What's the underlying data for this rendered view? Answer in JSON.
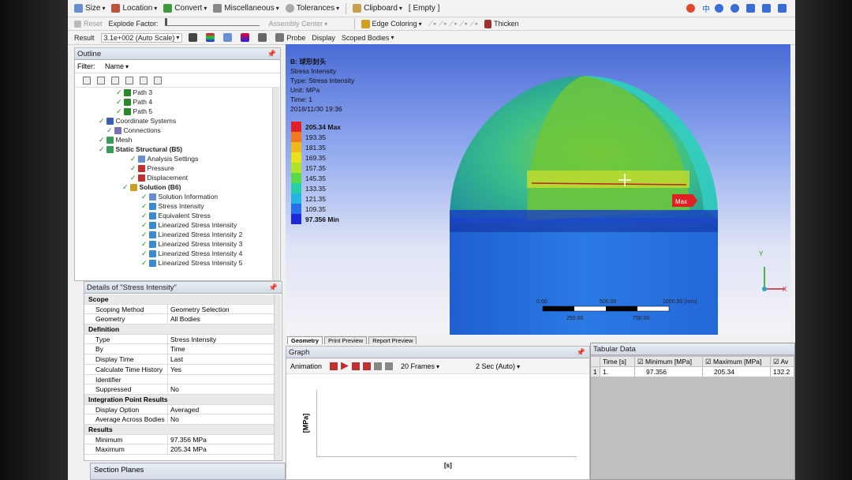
{
  "toolbar1": {
    "size": "Size",
    "location": "Location",
    "convert": "Convert",
    "misc": "Miscellaneous",
    "tolerances": "Tolerances",
    "clipboard": "Clipboard",
    "empty": "[ Empty ]"
  },
  "toolbar2": {
    "reset": "Reset",
    "explode": "Explode Factor:",
    "assembly": "Assembly Center",
    "edge_coloring": "Edge Coloring",
    "thicken": "Thicken"
  },
  "toolbar3": {
    "result_label": "Result",
    "scale": "3.1e+002 (Auto Scale)",
    "probe": "Probe",
    "display": "Display",
    "scoped": "Scoped Bodies"
  },
  "outline": {
    "title": "Outline",
    "filter_label": "Filter:",
    "filter_value": "Name",
    "items": [
      {
        "label": "Path 3",
        "indent": 0
      },
      {
        "label": "Path 4",
        "indent": 0
      },
      {
        "label": "Path 5",
        "indent": 0
      },
      {
        "label": "Coordinate Systems",
        "indent": 0
      },
      {
        "label": "Connections",
        "indent": 0
      },
      {
        "label": "Mesh",
        "indent": 0
      },
      {
        "label": "Static Structural (B5)",
        "indent": 0
      },
      {
        "label": "Analysis Settings",
        "indent": 1
      },
      {
        "label": "Pressure",
        "indent": 1
      },
      {
        "label": "Displacement",
        "indent": 1
      },
      {
        "label": "Solution (B6)",
        "indent": 1
      },
      {
        "label": "Solution Information",
        "indent": 2
      },
      {
        "label": "Stress Intensity",
        "indent": 2
      },
      {
        "label": "Equivalent Stress",
        "indent": 2
      },
      {
        "label": "Linearized Stress Intensity",
        "indent": 2
      },
      {
        "label": "Linearized Stress Intensity 2",
        "indent": 2
      },
      {
        "label": "Linearized Stress Intensity 3",
        "indent": 2
      },
      {
        "label": "Linearized Stress Intensity 4",
        "indent": 2
      },
      {
        "label": "Linearized Stress Intensity 5",
        "indent": 2
      }
    ]
  },
  "details": {
    "title": "Details of \"Stress Intensity\"",
    "rows": [
      {
        "k": "Scope",
        "v": "",
        "section": true
      },
      {
        "k": "Scoping Method",
        "v": "Geometry Selection"
      },
      {
        "k": "Geometry",
        "v": "All Bodies"
      },
      {
        "k": "Definition",
        "v": "",
        "section": true
      },
      {
        "k": "Type",
        "v": "Stress Intensity"
      },
      {
        "k": "By",
        "v": "Time"
      },
      {
        "k": "Display Time",
        "v": "Last"
      },
      {
        "k": "Calculate Time History",
        "v": "Yes"
      },
      {
        "k": "Identifier",
        "v": ""
      },
      {
        "k": "Suppressed",
        "v": "No"
      },
      {
        "k": "Integration Point Results",
        "v": "",
        "section": true
      },
      {
        "k": "Display Option",
        "v": "Averaged"
      },
      {
        "k": "Average Across Bodies",
        "v": "No"
      },
      {
        "k": "Results",
        "v": "",
        "section": true
      },
      {
        "k": "Minimum",
        "v": "97.356 MPa"
      },
      {
        "k": "Maximum",
        "v": "205.34 MPa"
      }
    ]
  },
  "section_planes": "Section Planes",
  "viewport": {
    "line1": "B: 球形封头",
    "line2": "Stress Intensity",
    "line3": "Type: Stress Intensity",
    "line4": "Unit: MPa",
    "line5": "Time: 1",
    "line6": "2018/11/30 19:36",
    "max_tag": "Max",
    "scale_top": [
      "0.00",
      "500.00",
      "1000.00 (mm)"
    ],
    "scale_bottom": [
      "250.00",
      "750.00"
    ],
    "axis_y": "Y",
    "axis_x": "X"
  },
  "legend": [
    {
      "label": "205.34 Max",
      "color": "#e0202a",
      "bold": true
    },
    {
      "label": "193.35",
      "color": "#f07a1a"
    },
    {
      "label": "181.35",
      "color": "#f0b81a"
    },
    {
      "label": "169.35",
      "color": "#e8e21e"
    },
    {
      "label": "157.35",
      "color": "#b0e22a"
    },
    {
      "label": "145.35",
      "color": "#5ad84a"
    },
    {
      "label": "133.35",
      "color": "#26d0a6"
    },
    {
      "label": "121.35",
      "color": "#26b4e2"
    },
    {
      "label": "109.35",
      "color": "#2670e8"
    },
    {
      "label": "97.356 Min",
      "color": "#1e28d4",
      "bold": true
    }
  ],
  "view_tabs": [
    "Geometry",
    "Print Preview",
    "Report Preview"
  ],
  "graph": {
    "title": "Graph",
    "animation": "Animation",
    "frames": "20 Frames",
    "duration": "2 Sec (Auto)",
    "ylabel": "[MPa]",
    "xlabel": "[s]"
  },
  "tabular": {
    "title": "Tabular Data",
    "headers": [
      "Time [s]",
      "Minimum [MPa]",
      "Maximum [MPa]",
      "Av"
    ],
    "row": [
      "1",
      "1.",
      "97.356",
      "205.34",
      "132.2"
    ]
  },
  "colors": {
    "accent": "#2a6fc9"
  }
}
